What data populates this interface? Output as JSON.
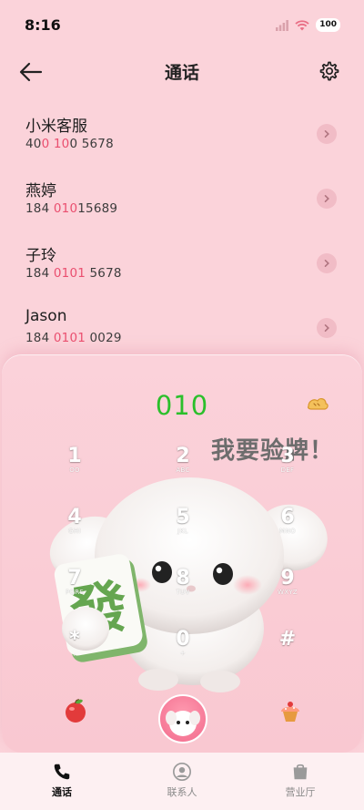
{
  "status_bar": {
    "time": "8:16",
    "battery": "100"
  },
  "header": {
    "title": "通话",
    "icons": [
      "back-arrow-icon",
      "settings-gear-icon"
    ]
  },
  "contacts": [
    {
      "name": "小米客服",
      "number_parts": [
        "40",
        "0 10",
        "0 5678"
      ]
    },
    {
      "name": "燕婷",
      "number_parts": [
        "184 ",
        "010",
        "15689"
      ]
    },
    {
      "name": "子玲",
      "number_parts": [
        "184 ",
        "0101",
        " 5678"
      ]
    },
    {
      "name": "Jason",
      "number_parts": [
        "184 ",
        "0101",
        " 0029"
      ]
    }
  ],
  "dialer": {
    "input": "010",
    "mascot_text": "我要验牌！",
    "tile_character": "發",
    "keys": [
      {
        "digit": "1",
        "letters": "OO"
      },
      {
        "digit": "2",
        "letters": "ABC"
      },
      {
        "digit": "3",
        "letters": "DEF"
      },
      {
        "digit": "4",
        "letters": "GHI"
      },
      {
        "digit": "5",
        "letters": "JKL"
      },
      {
        "digit": "6",
        "letters": "MNO"
      },
      {
        "digit": "7",
        "letters": "PQRS"
      },
      {
        "digit": "8",
        "letters": "TUV"
      },
      {
        "digit": "9",
        "letters": "WXYZ"
      },
      {
        "digit": "*",
        "letters": ","
      },
      {
        "digit": "0",
        "letters": "+"
      },
      {
        "digit": "#",
        "letters": ""
      }
    ]
  },
  "bottom_nav": [
    {
      "label": "通话",
      "icon": "phone-icon",
      "active": true
    },
    {
      "label": "联系人",
      "icon": "contacts-person-icon",
      "active": false
    },
    {
      "label": "营业厅",
      "icon": "shopping-bag-icon",
      "active": false
    }
  ],
  "colors": {
    "background": "#fbd3da",
    "accent_green": "#2bbf2b",
    "highlight_pink": "#ea4f6f"
  }
}
